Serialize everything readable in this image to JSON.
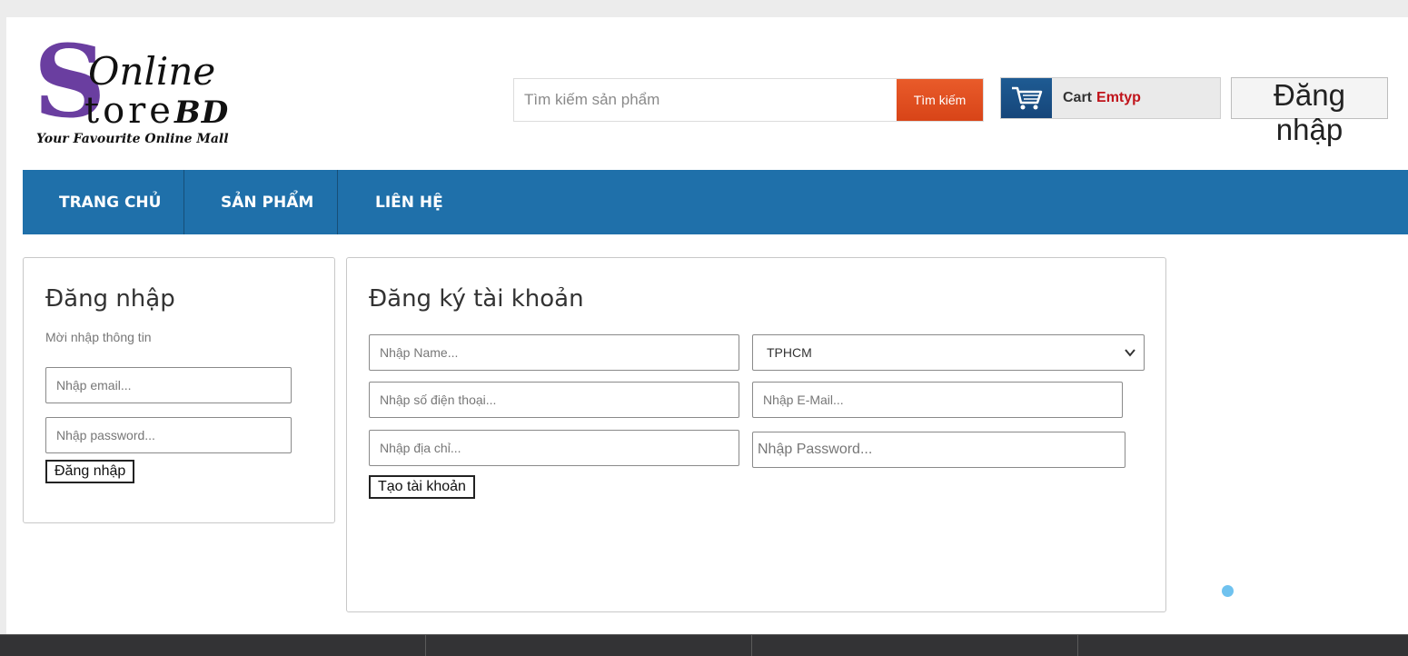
{
  "brand": {
    "logo_s": "S",
    "logo_online": "Online",
    "logo_store": "tore",
    "logo_bd": "BD",
    "tagline": "Your Favourite Online Mall",
    "purple": "#6a3ea0"
  },
  "search": {
    "placeholder": "Tìm kiếm sản phẩm",
    "button_label": "Tìm kiếm"
  },
  "cart": {
    "icon": "shopping-cart-icon",
    "label": "Cart",
    "status": "Emtyp"
  },
  "header": {
    "login_button": "Đăng nhập"
  },
  "nav": {
    "color": "#1f70aa",
    "items": [
      {
        "label": "TRANG CHỦ"
      },
      {
        "label": "SẢN PHẨM"
      },
      {
        "label": "LIÊN HỆ"
      }
    ]
  },
  "login": {
    "title": "Đăng nhập",
    "hint": "Mời nhập thông tin",
    "email_placeholder": "Nhập email...",
    "password_placeholder": "Nhập password...",
    "submit_label": "Đăng nhập"
  },
  "register": {
    "title": "Đăng ký tài khoản",
    "name_placeholder": "Nhập Name...",
    "phone_placeholder": "Nhập số điện thoại...",
    "address_placeholder": "Nhập địa chỉ...",
    "city_selected": "TPHCM",
    "email_placeholder": "Nhập E-Mail...",
    "password_placeholder": "Nhập Password...",
    "submit_label": "Tạo tài khoản"
  }
}
